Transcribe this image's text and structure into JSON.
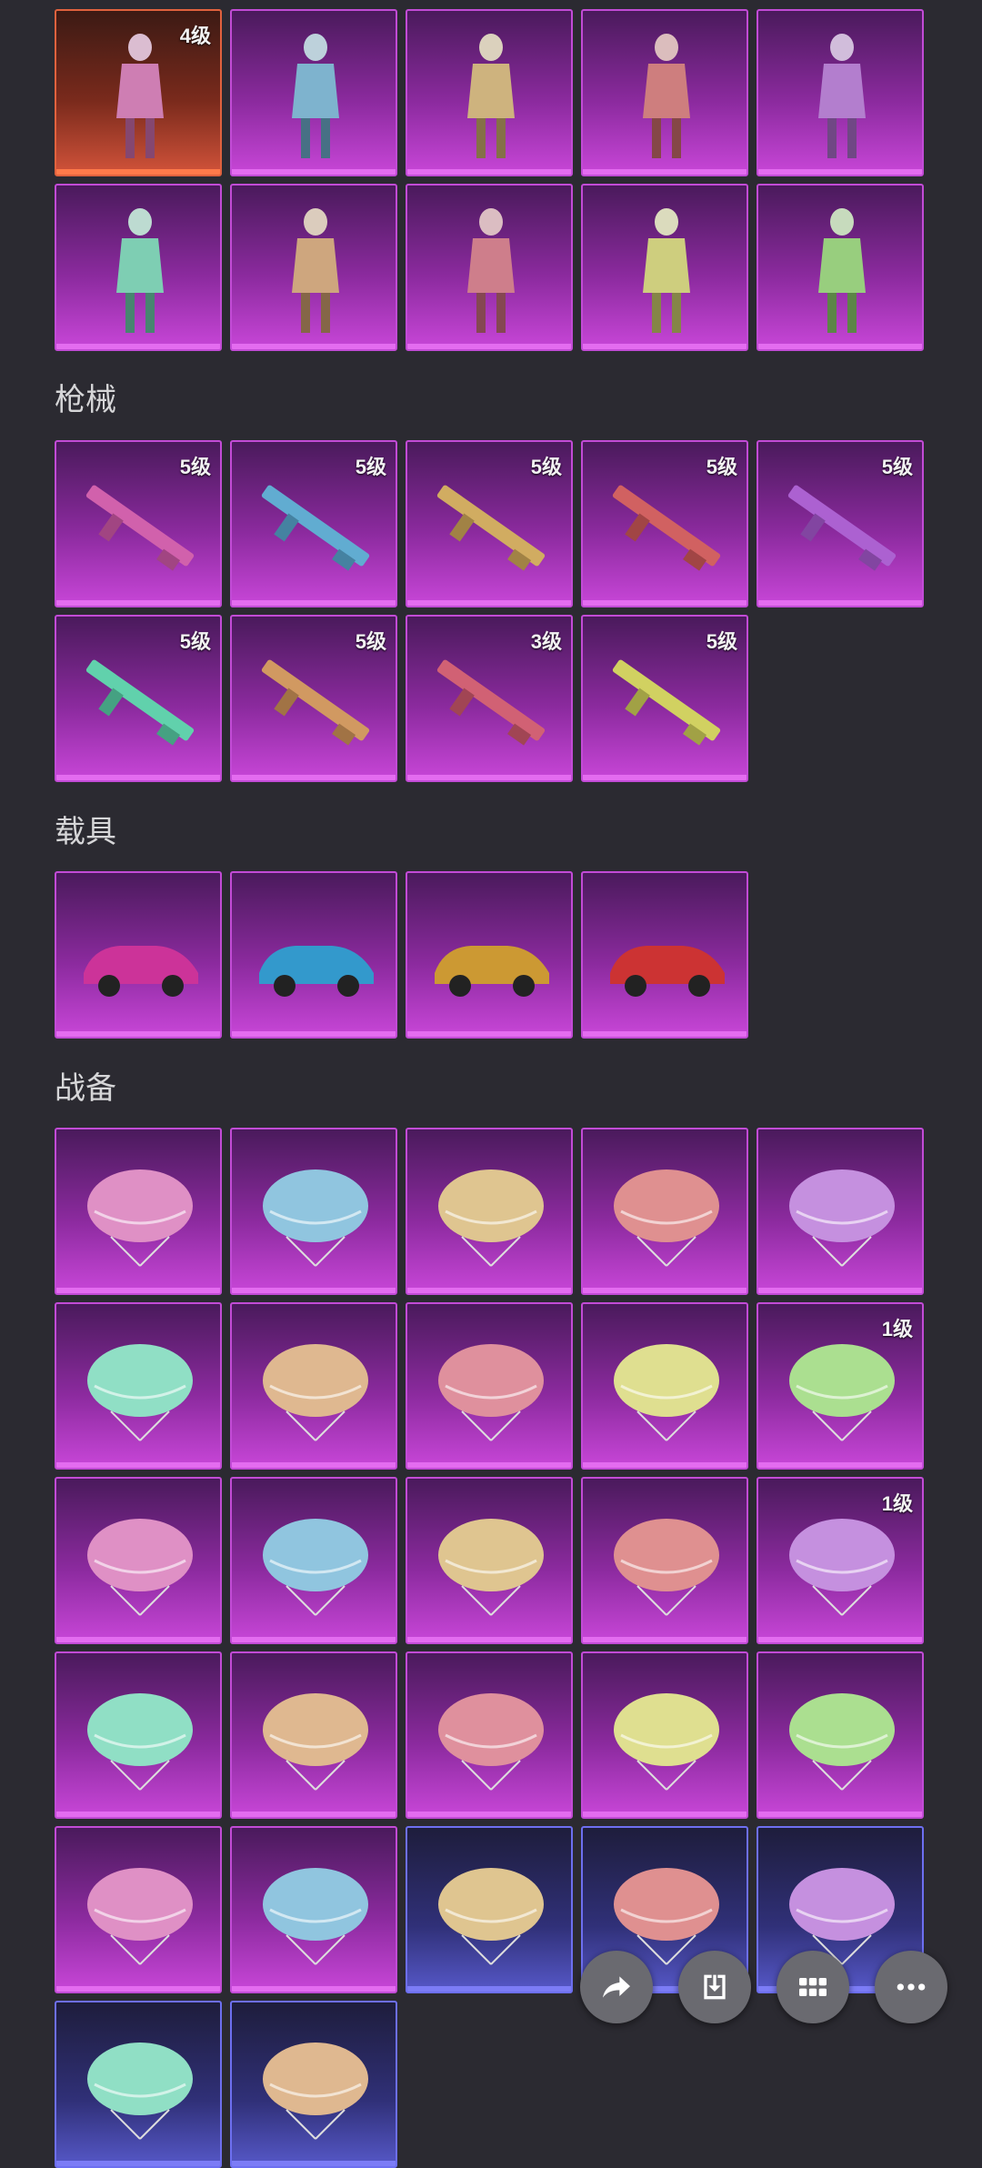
{
  "sections": {
    "guns": "枪械",
    "vehicles": "载具",
    "gear": "战备"
  },
  "outfits": [
    {
      "badge": "4级",
      "name": "mummy-outfit-icon",
      "rarity": "legendary"
    },
    {
      "badge": "",
      "name": "silver-suit-duo-icon",
      "rarity": "epic"
    },
    {
      "badge": "",
      "name": "white-dress-character-icon",
      "rarity": "epic"
    },
    {
      "badge": "",
      "name": "red-white-character-icon",
      "rarity": "epic"
    },
    {
      "badge": "",
      "name": "pink-gown-character-icon",
      "rarity": "epic"
    },
    {
      "badge": "",
      "name": "dark-suit-duo-icon",
      "rarity": "epic"
    },
    {
      "badge": "",
      "name": "yellow-dress-character-icon",
      "rarity": "epic"
    },
    {
      "badge": "",
      "name": "red-kimono-character-icon",
      "rarity": "epic"
    },
    {
      "badge": "",
      "name": "white-hoodie-character-icon",
      "rarity": "epic"
    },
    {
      "badge": "",
      "name": "green-costume-set-icon",
      "rarity": "epic"
    }
  ],
  "guns": [
    {
      "badge": "5级",
      "name": "rifle-skin-1-icon"
    },
    {
      "badge": "5级",
      "name": "rifle-skin-2-icon"
    },
    {
      "badge": "5级",
      "name": "machine-gun-skin-icon"
    },
    {
      "badge": "5级",
      "name": "sniper-skin-icon"
    },
    {
      "badge": "5级",
      "name": "smg-skin-icon"
    },
    {
      "badge": "5级",
      "name": "pink-rifle-skin-icon"
    },
    {
      "badge": "5级",
      "name": "pink-m416-skin-icon"
    },
    {
      "badge": "3级",
      "name": "golden-rifle-skin-icon"
    },
    {
      "badge": "5级",
      "name": "akm-skin-icon"
    }
  ],
  "vehicles": [
    {
      "badge": "",
      "name": "red-sports-car-icon"
    },
    {
      "badge": "",
      "name": "unicorn-mount-icon"
    },
    {
      "badge": "",
      "name": "black-motorcycle-icon"
    },
    {
      "badge": "",
      "name": "purple-coupe-icon"
    }
  ],
  "gear": [
    {
      "badge": "",
      "name": "crystal-parachute-icon",
      "rarity": "epic"
    },
    {
      "badge": "",
      "name": "pink-glider-icon",
      "rarity": "epic"
    },
    {
      "badge": "",
      "name": "blue-round-parachute-icon",
      "rarity": "epic"
    },
    {
      "badge": "",
      "name": "cat-parachute-icon",
      "rarity": "epic"
    },
    {
      "badge": "",
      "name": "spiky-glider-icon",
      "rarity": "epic"
    },
    {
      "badge": "",
      "name": "gamer-parachute-icon",
      "rarity": "epic"
    },
    {
      "badge": "",
      "name": "bow-parachute-icon",
      "rarity": "epic"
    },
    {
      "badge": "",
      "name": "golden-glider-icon",
      "rarity": "epic"
    },
    {
      "badge": "",
      "name": "floral-parachute-icon",
      "rarity": "epic"
    },
    {
      "badge": "1级",
      "name": "dragon-mount-icon",
      "rarity": "epic"
    },
    {
      "badge": "",
      "name": "dark-feather-parachute-icon",
      "rarity": "epic"
    },
    {
      "badge": "",
      "name": "white-glider-icon",
      "rarity": "epic"
    },
    {
      "badge": "",
      "name": "ribbon-parachute-icon",
      "rarity": "epic"
    },
    {
      "badge": "",
      "name": "gold-purple-glider-icon",
      "rarity": "epic"
    },
    {
      "badge": "1级",
      "name": "pegasus-chariot-icon",
      "rarity": "epic"
    },
    {
      "badge": "",
      "name": "striped-parachute-icon",
      "rarity": "epic"
    },
    {
      "badge": "",
      "name": "bunny-parachute-icon",
      "rarity": "epic"
    },
    {
      "badge": "",
      "name": "orange-flower-parachute-icon",
      "rarity": "epic"
    },
    {
      "badge": "",
      "name": "black-cat-parachute-icon",
      "rarity": "epic"
    },
    {
      "badge": "",
      "name": "lemon-parachute-icon",
      "rarity": "epic"
    },
    {
      "badge": "",
      "name": "zebra-glider-icon",
      "rarity": "epic"
    },
    {
      "badge": "",
      "name": "golden-box-glider-icon",
      "rarity": "epic"
    },
    {
      "badge": "",
      "name": "white-doll-companion-icon",
      "rarity": "rare"
    },
    {
      "badge": "",
      "name": "chicken-companion-icon",
      "rarity": "rare"
    },
    {
      "badge": "",
      "name": "pink-bird-companion-icon",
      "rarity": "rare"
    },
    {
      "badge": "",
      "name": "yellow-chick-companion-icon",
      "rarity": "rare"
    },
    {
      "badge": "",
      "name": "helmet-chick-companion-icon",
      "rarity": "rare"
    }
  ],
  "actions": [
    {
      "name": "share-icon"
    },
    {
      "name": "download-icon"
    },
    {
      "name": "grid-view-icon"
    },
    {
      "name": "more-icon"
    }
  ],
  "colors": {
    "background": "#2b2a31",
    "epic": "#c846d8",
    "legendary": "#d2533a",
    "rare": "#5658c8"
  }
}
